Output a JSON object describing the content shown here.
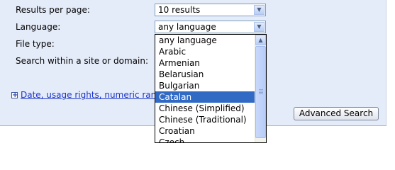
{
  "form": {
    "results_label": "Results per page:",
    "results_value": "10 results",
    "language_label": "Language:",
    "language_value": "any language",
    "filetype_label": "File type:",
    "site_label": "Search within a site or domain:",
    "more_options_link": "Date, usage rights, numeric rang",
    "advanced_button": "Advanced Search"
  },
  "dropdown": {
    "options": [
      "any language",
      "Arabic",
      "Armenian",
      "Belarusian",
      "Bulgarian",
      "Catalan",
      "Chinese (Simplified)",
      "Chinese (Traditional)",
      "Croatian",
      "Czech"
    ],
    "highlighted": "Catalan"
  },
  "icons": {
    "select_arrow": "chevron-down-icon",
    "expand": "plus-icon",
    "scroll_up": "chevron-up-icon"
  },
  "colors": {
    "panel_bg": "#e5ecf9",
    "highlight": "#316ac5",
    "link": "#1a33cc"
  }
}
